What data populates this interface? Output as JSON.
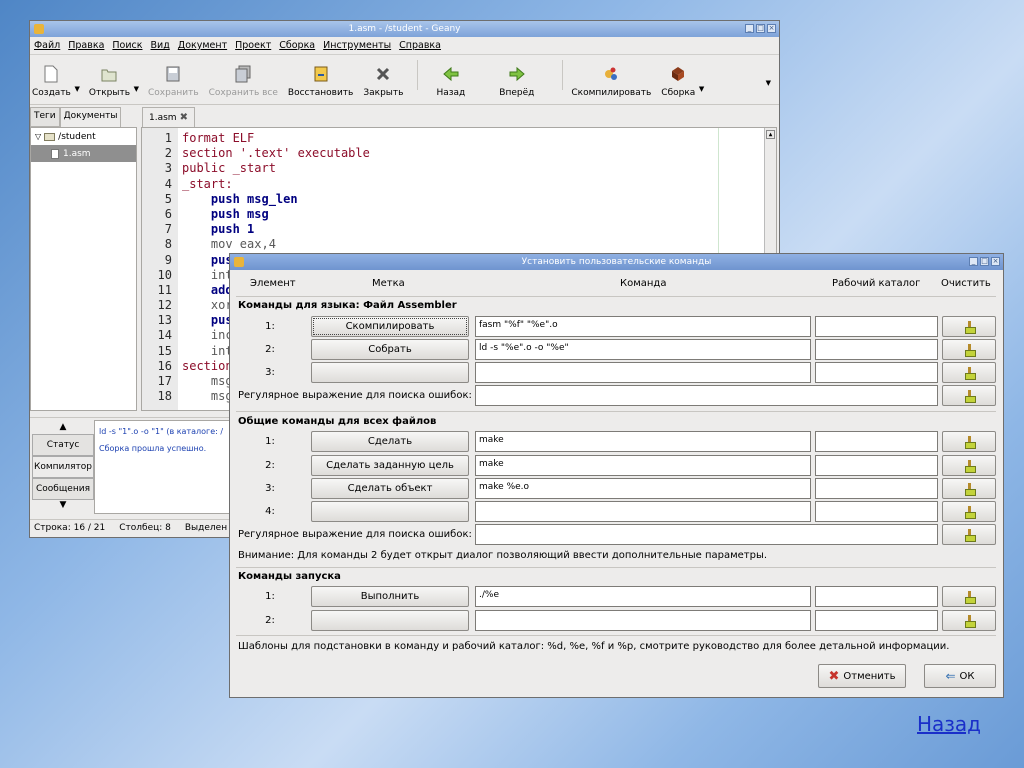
{
  "geany": {
    "title": "1.asm - /student - Geany",
    "menu": [
      "Файл",
      "Правка",
      "Поиск",
      "Вид",
      "Документ",
      "Проект",
      "Сборка",
      "Инструменты",
      "Справка"
    ],
    "toolbar": {
      "create": "Создать",
      "open": "Открыть",
      "save": "Сохранить",
      "save_all": "Сохранить все",
      "revert": "Восстановить",
      "close": "Закрыть",
      "back": "Назад",
      "forward": "Вперёд",
      "compile": "Скомпилировать",
      "build": "Сборка"
    },
    "side_tabs": [
      "Теги",
      "Документы"
    ],
    "tree": {
      "folder": "/student",
      "file": "1.asm"
    },
    "doc_tab": "1.asm",
    "code_lines": [
      {
        "n": "1",
        "text": "format ELF"
      },
      {
        "n": "2",
        "text": "section '.text' executable"
      },
      {
        "n": "3",
        "text": "public _start"
      },
      {
        "n": "4",
        "text": "_start:"
      },
      {
        "n": "5",
        "text": "    push msg_len"
      },
      {
        "n": "6",
        "text": "    push msg"
      },
      {
        "n": "7",
        "text": "    push 1"
      },
      {
        "n": "8",
        "text": "    mov eax,4"
      },
      {
        "n": "9",
        "text": "    pus"
      },
      {
        "n": "10",
        "text": "    int"
      },
      {
        "n": "11",
        "text": "    add"
      },
      {
        "n": "12",
        "text": "    xor"
      },
      {
        "n": "13",
        "text": "    pus"
      },
      {
        "n": "14",
        "text": "    inc"
      },
      {
        "n": "15",
        "text": "    int"
      },
      {
        "n": "16",
        "text": "section"
      },
      {
        "n": "17",
        "text": "    msg"
      },
      {
        "n": "18",
        "text": "    msg"
      }
    ],
    "msg_tabs": [
      "Статус",
      "Компилятор",
      "Сообщения"
    ],
    "messages": [
      "ld -s \"1\".o -o \"1\" (в каталоге: /",
      "Сборка прошла успешно."
    ],
    "status": {
      "line": "Строка: 16 / 21",
      "col": "Столбец: 8",
      "sel": "Выделен"
    }
  },
  "dialog": {
    "title": "Установить пользовательские команды",
    "headers": {
      "element": "Элемент",
      "label": "Метка",
      "command": "Команда",
      "workdir": "Рабочий каталог",
      "clear": "Очистить"
    },
    "lang_section": "Команды для языка: Файл Assembler",
    "lang_rows": [
      {
        "idx": "1:",
        "label": "Скомпилировать",
        "cmd": "fasm \"%f\" \"%e\".o"
      },
      {
        "idx": "2:",
        "label": "Собрать",
        "cmd": "ld -s \"%e\".o -o \"%e\""
      },
      {
        "idx": "3:",
        "label": "",
        "cmd": ""
      }
    ],
    "regex_label": "Регулярное выражение для поиска ошибок:",
    "common_section": "Общие команды для всех файлов",
    "common_rows": [
      {
        "idx": "1:",
        "label": "Сделать",
        "cmd": "make"
      },
      {
        "idx": "2:",
        "label": "Сделать заданную цель",
        "cmd": "make"
      },
      {
        "idx": "3:",
        "label": "Сделать объект",
        "cmd": "make %e.o"
      },
      {
        "idx": "4:",
        "label": "",
        "cmd": ""
      }
    ],
    "regex_label2": "Регулярное выражение для поиска ошибок:",
    "warning": "Внимание: Для команды 2 будет открыт диалог позволяющий ввести дополнительные параметры.",
    "run_section": "Команды запуска",
    "run_rows": [
      {
        "idx": "1:",
        "label": "Выполнить",
        "cmd": "./%e"
      },
      {
        "idx": "2:",
        "label": "",
        "cmd": ""
      }
    ],
    "templates_note": "Шаблоны для подстановки в команду и рабочий каталог: %d, %e, %f и %p, смотрите руководство для более детальной информации.",
    "cancel": "Отменить",
    "ok": "ОК"
  },
  "back_link": "Назад"
}
